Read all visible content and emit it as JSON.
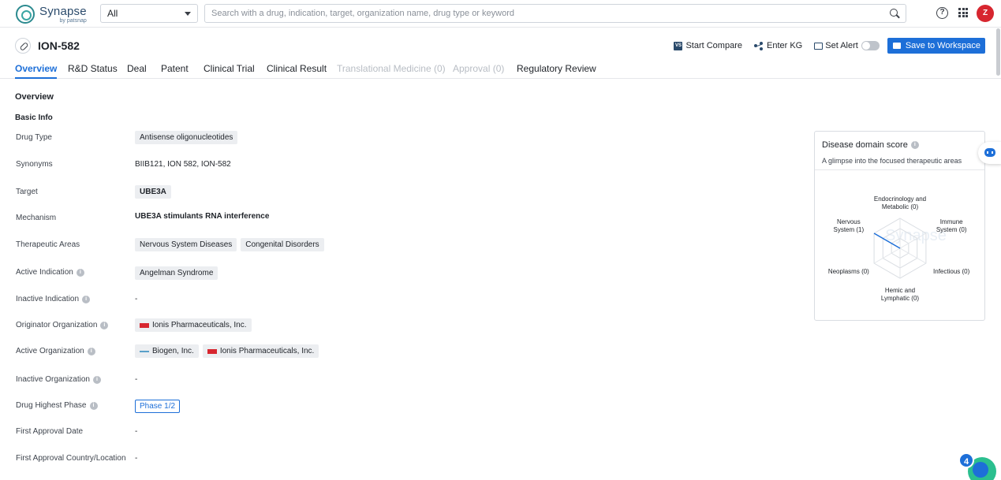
{
  "topbar": {
    "logo_name": "Synapse",
    "logo_by": "by patsnap",
    "scope_value": "All",
    "search_placeholder": "Search with a drug, indication, target, organization name, drug type or keyword",
    "avatar_letter": "Z"
  },
  "header": {
    "drug_name": "ION-582",
    "start_compare": "Start Compare",
    "vs_badge": "VS",
    "enter_kg": "Enter KG",
    "set_alert": "Set Alert",
    "save_workspace": "Save to Workspace"
  },
  "tabs": [
    {
      "label": "Overview",
      "state": "active"
    },
    {
      "label": "R&D Status",
      "state": "normal"
    },
    {
      "label": "Deal",
      "state": "normal"
    },
    {
      "label": "Patent",
      "state": "normal"
    },
    {
      "label": "Clinical Trial",
      "state": "normal"
    },
    {
      "label": "Clinical Result",
      "state": "normal"
    },
    {
      "label": "Translational Medicine (0)",
      "state": "disabled"
    },
    {
      "label": "Approval (0)",
      "state": "disabled"
    },
    {
      "label": "Regulatory Review",
      "state": "normal"
    }
  ],
  "overview": {
    "section_title": "Overview",
    "basic_info_title": "Basic Info",
    "rows": {
      "drug_type": {
        "label": "Drug Type",
        "tags": [
          "Antisense oligonucleotides"
        ]
      },
      "synonyms": {
        "label": "Synonyms",
        "value": "BIIB121,  ION 582,  ION-582"
      },
      "target": {
        "label": "Target",
        "tags": [
          "UBE3A"
        ]
      },
      "mechanism": {
        "label": "Mechanism",
        "value": "UBE3A stimulants  RNA interference"
      },
      "therapeutic_areas": {
        "label": "Therapeutic Areas",
        "tags": [
          "Nervous System Diseases",
          "Congenital Disorders"
        ]
      },
      "active_indication": {
        "label": "Active Indication",
        "tags": [
          "Angelman Syndrome"
        ]
      },
      "inactive_indication": {
        "label": "Inactive Indication",
        "value": "-"
      },
      "originator_org": {
        "label": "Originator Organization",
        "orgs": [
          {
            "name": "Ionis Pharmaceuticals, Inc.",
            "logo": "ionis-logo"
          }
        ]
      },
      "active_org": {
        "label": "Active Organization",
        "orgs": [
          {
            "name": "Biogen, Inc.",
            "logo": "biogen-logo"
          },
          {
            "name": "Ionis Pharmaceuticals, Inc.",
            "logo": "ionis-logo"
          }
        ]
      },
      "inactive_org": {
        "label": "Inactive Organization",
        "value": "-"
      },
      "highest_phase": {
        "label": "Drug Highest Phase",
        "phase": "Phase 1/2"
      },
      "first_approval_date": {
        "label": "First Approval Date",
        "value": "-"
      },
      "first_approval_country": {
        "label": "First Approval Country/Location",
        "value": "-"
      }
    }
  },
  "disease_score": {
    "title": "Disease domain score",
    "subtitle": "A glimpse into the focused therapeutic areas",
    "watermark": "Synapse",
    "axes": [
      {
        "label_lines": [
          "Endocrinology and",
          "Metabolic (0)"
        ],
        "score": 0
      },
      {
        "label_lines": [
          "Immune",
          "System (0)"
        ],
        "score": 0
      },
      {
        "label_lines": [
          "Infectious (0)"
        ],
        "score": 0
      },
      {
        "label_lines": [
          "Hemic and",
          "Lymphatic (0)"
        ],
        "score": 0
      },
      {
        "label_lines": [
          "Neoplasms (0)"
        ],
        "score": 0
      },
      {
        "label_lines": [
          "Nervous",
          "System (1)"
        ],
        "score": 1
      }
    ],
    "max_score": 1,
    "line_color": "#1d6fd8"
  },
  "floating": {
    "notification_count": "4"
  },
  "colors": {
    "accent": "#1d6fd8",
    "avatar": "#d7262f",
    "tag_bg": "#eceef1"
  }
}
